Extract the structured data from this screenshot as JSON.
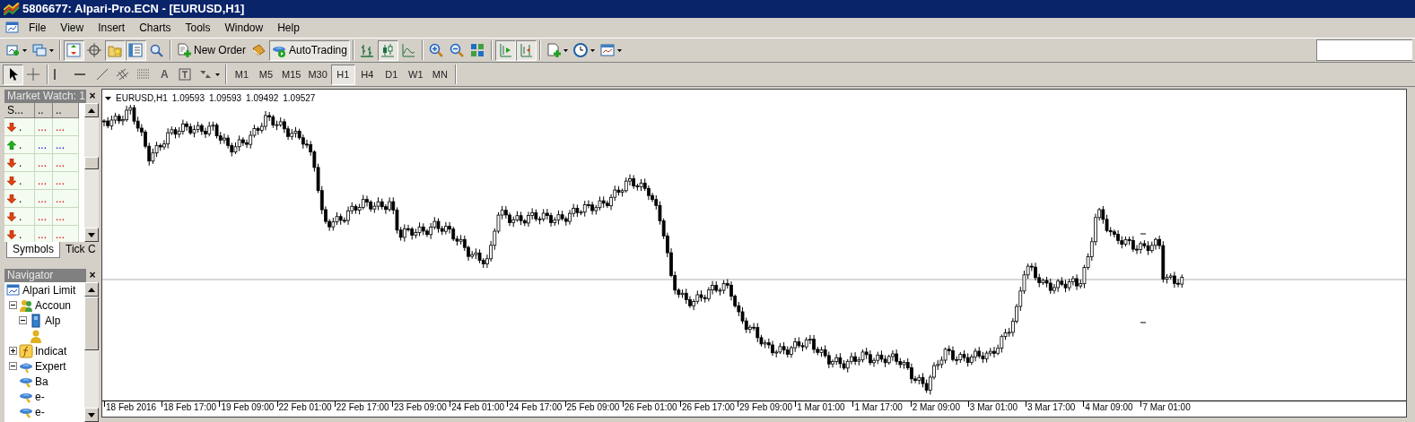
{
  "window": {
    "title": "5806677: Alpari-Pro.ECN - [EURUSD,H1]"
  },
  "menu": [
    "File",
    "View",
    "Insert",
    "Charts",
    "Tools",
    "Window",
    "Help"
  ],
  "toolbar": [
    {
      "kind": "new-chart",
      "pressed": false,
      "dropdown": true
    },
    {
      "kind": "profiles",
      "pressed": false,
      "dropdown": true
    },
    {
      "kind": "separator"
    },
    {
      "kind": "market-watch",
      "pressed": true,
      "dropdown": false
    },
    {
      "kind": "crosshair",
      "pressed": false,
      "dropdown": false
    },
    {
      "kind": "navigator",
      "pressed": true,
      "dropdown": false
    },
    {
      "kind": "terminal",
      "pressed": true,
      "dropdown": false
    },
    {
      "kind": "tester",
      "pressed": false,
      "dropdown": false
    },
    {
      "kind": "separator"
    },
    {
      "kind": "new-order",
      "pressed": false,
      "dropdown": false,
      "label": "New Order"
    },
    {
      "kind": "editor",
      "pressed": false,
      "dropdown": false
    },
    {
      "kind": "autotrading",
      "pressed": true,
      "dropdown": false,
      "label": "AutoTrading"
    },
    {
      "kind": "separator"
    },
    {
      "kind": "bar-chart",
      "pressed": false,
      "dropdown": false
    },
    {
      "kind": "candles",
      "pressed": true,
      "dropdown": false
    },
    {
      "kind": "line-chart",
      "pressed": false,
      "dropdown": false
    },
    {
      "kind": "separator"
    },
    {
      "kind": "zoom-in",
      "pressed": false,
      "dropdown": false
    },
    {
      "kind": "zoom-out",
      "pressed": false,
      "dropdown": false
    },
    {
      "kind": "tile",
      "pressed": false,
      "dropdown": false
    },
    {
      "kind": "separator"
    },
    {
      "kind": "auto-scroll",
      "pressed": true,
      "dropdown": false
    },
    {
      "kind": "chart-shift",
      "pressed": true,
      "dropdown": false
    },
    {
      "kind": "separator"
    },
    {
      "kind": "indicators",
      "pressed": false,
      "dropdown": true
    },
    {
      "kind": "periods",
      "pressed": false,
      "dropdown": true
    },
    {
      "kind": "templates",
      "pressed": false,
      "dropdown": true
    }
  ],
  "drawing_tools": [
    {
      "kind": "cursor",
      "pressed": true,
      "dropdown": false
    },
    {
      "kind": "cross",
      "pressed": false,
      "dropdown": false
    },
    {
      "kind": "separator"
    },
    {
      "kind": "vline",
      "pressed": false,
      "dropdown": false
    },
    {
      "kind": "hline",
      "pressed": false,
      "dropdown": false
    },
    {
      "kind": "trendline",
      "pressed": false,
      "dropdown": false
    },
    {
      "kind": "channel",
      "pressed": false,
      "dropdown": false
    },
    {
      "kind": "fibo",
      "pressed": false,
      "dropdown": false
    },
    {
      "kind": "text",
      "pressed": false,
      "dropdown": false,
      "label": "A"
    },
    {
      "kind": "text-label",
      "pressed": false,
      "dropdown": false
    },
    {
      "kind": "arrows",
      "pressed": false,
      "dropdown": true
    }
  ],
  "timeframes": [
    {
      "label": "M1",
      "selected": false
    },
    {
      "label": "M5",
      "selected": false
    },
    {
      "label": "M15",
      "selected": false
    },
    {
      "label": "M30",
      "selected": false
    },
    {
      "label": "H1",
      "selected": true
    },
    {
      "label": "H4",
      "selected": false
    },
    {
      "label": "D1",
      "selected": false
    },
    {
      "label": "W1",
      "selected": false
    },
    {
      "label": "MN",
      "selected": false
    }
  ],
  "market_watch": {
    "title": "Market Watch: 1",
    "close": "×",
    "columns": [
      "S...",
      "..",
      ".."
    ],
    "rows": [
      {
        "kind": "down",
        "symbol": ".",
        "bid": "...",
        "ask": "..."
      },
      {
        "kind": "up",
        "symbol": ".",
        "bid": "...",
        "ask": "..."
      },
      {
        "kind": "down",
        "symbol": ".",
        "bid": "...",
        "ask": "..."
      },
      {
        "kind": "down",
        "symbol": ".",
        "bid": "...",
        "ask": "..."
      },
      {
        "kind": "down",
        "symbol": ".",
        "bid": "...",
        "ask": "..."
      },
      {
        "kind": "down",
        "symbol": ".",
        "bid": "...",
        "ask": "..."
      },
      {
        "kind": "down",
        "symbol": ".",
        "bid": "...",
        "ask": "..."
      }
    ],
    "tabs": [
      {
        "label": "Symbols",
        "selected": true
      },
      {
        "label": "Tick C",
        "selected": false
      }
    ]
  },
  "navigator": {
    "title": "Navigator",
    "close": "×",
    "tree": [
      {
        "kind": "broker",
        "label": "Alpari Limit",
        "children": [
          {
            "kind": "accounts",
            "label": "Accoun",
            "expanded": true,
            "children": [
              {
                "kind": "server",
                "label": "Alp",
                "expanded": true,
                "children": [
                  {
                    "kind": "account"
                  }
                ]
              }
            ]
          },
          {
            "kind": "indicators",
            "label": "Indicat",
            "expanded": false
          },
          {
            "kind": "experts",
            "label": "Expert",
            "expanded": true,
            "children": [
              {
                "kind": "expert",
                "label": "Ba"
              },
              {
                "kind": "expert",
                "label": "e-"
              },
              {
                "kind": "expert",
                "label": "e-"
              }
            ]
          }
        ]
      }
    ]
  },
  "chart": {
    "symbol": "EURUSD,H1",
    "ohlc": [
      "1.09593",
      "1.09593",
      "1.09492",
      "1.09527"
    ],
    "time_labels": [
      "18 Feb 2016",
      "18 Feb 17:00",
      "19 Feb 09:00",
      "22 Feb 01:00",
      "22 Feb 17:00",
      "23 Feb 09:00",
      "24 Feb 01:00",
      "24 Feb 17:00",
      "25 Feb 09:00",
      "26 Feb 01:00",
      "26 Feb 17:00",
      "29 Feb 09:00",
      "1 Mar 01:00",
      "1 Mar 17:00",
      "2 Mar 09:00",
      "3 Mar 01:00",
      "3 Mar 17:00",
      "4 Mar 09:00",
      "7 Mar 01:00"
    ]
  }
}
